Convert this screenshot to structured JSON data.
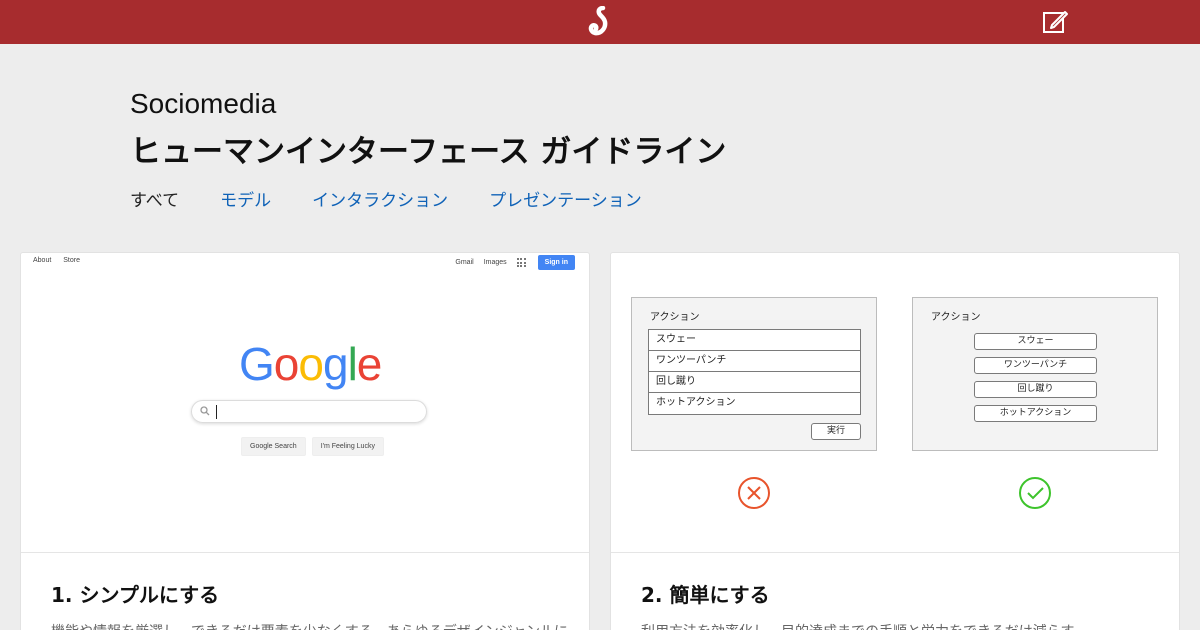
{
  "header": {
    "logo_icon": "sociomedia-logo",
    "edit_icon": "edit-note-icon",
    "bg_color": "#a72c2e"
  },
  "site": {
    "brand": "Sociomedia",
    "title": "ヒューマンインターフェース ガイドライン"
  },
  "nav": {
    "items": [
      {
        "label": "すべて",
        "active": true
      },
      {
        "label": "モデル",
        "active": false
      },
      {
        "label": "インタラクション",
        "active": false
      },
      {
        "label": "プレゼンテーション",
        "active": false
      }
    ],
    "link_color": "#0f62b7"
  },
  "cards": [
    {
      "title": "1. シンプルにする",
      "desc": "機能や情報を厳選し、できるだけ要素を少なくする。あらゆるデザインジャンルに",
      "mock": {
        "top_left": [
          "About",
          "Store"
        ],
        "top_right": [
          "Gmail",
          "Images"
        ],
        "signin": "Sign in",
        "logo_letters": [
          {
            "ch": "G",
            "color": "#4285f4"
          },
          {
            "ch": "o",
            "color": "#ea4335"
          },
          {
            "ch": "o",
            "color": "#fbbc05"
          },
          {
            "ch": "g",
            "color": "#4285f4"
          },
          {
            "ch": "l",
            "color": "#34a853"
          },
          {
            "ch": "e",
            "color": "#ea4335"
          }
        ],
        "btn_search": "Google Search",
        "btn_lucky": "I'm Feeling Lucky"
      }
    },
    {
      "title": "2. 簡単にする",
      "desc": "利用方法を効率化し、目的達成までの手順と労力をできるだけ減らす。",
      "bad_panel": {
        "title": "アクション",
        "items": [
          "スウェー",
          "ワンツーパンチ",
          "回し蹴り",
          "ホットアクション"
        ],
        "exec": "実行",
        "mark_icon": "cross-circle-icon",
        "mark_color": "#e8542c"
      },
      "good_panel": {
        "title": "アクション",
        "items": [
          "スウェー",
          "ワンツーパンチ",
          "回し蹴り",
          "ホットアクション"
        ],
        "mark_icon": "check-circle-icon",
        "mark_color": "#3ec42c"
      }
    }
  ]
}
